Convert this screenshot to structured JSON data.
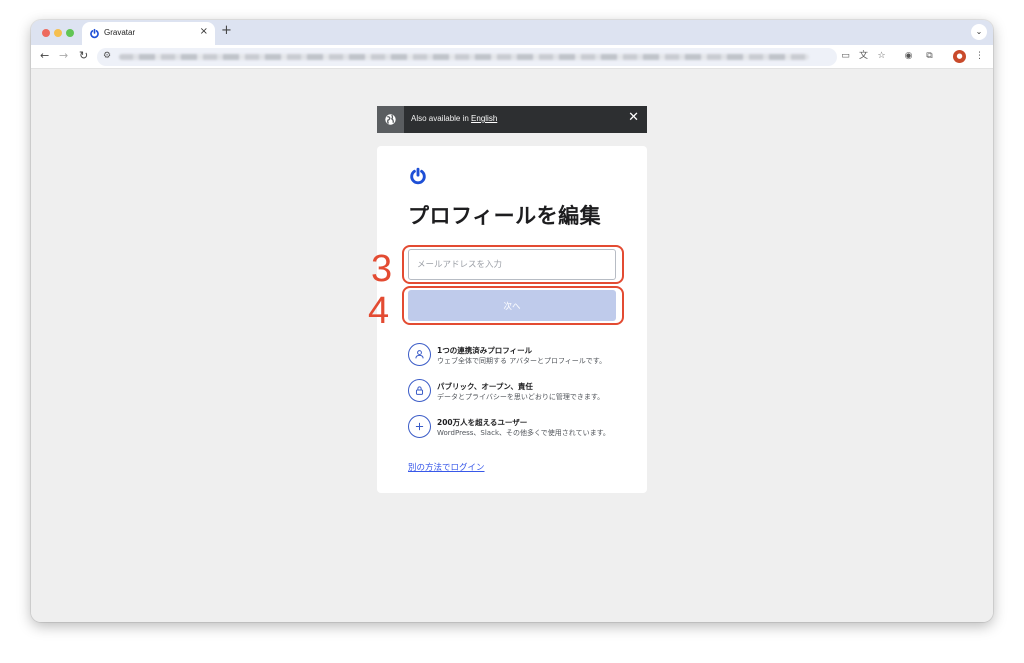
{
  "browser": {
    "tab_title": "Gravatar",
    "tab_close": "×",
    "new_tab": "+",
    "tab_search": "⌄",
    "nav": {
      "back": "←",
      "forward": "→",
      "reload": "↻"
    },
    "site_settings_icon": "⚙",
    "toolbar_icons": [
      "install-icon",
      "translate-icon",
      "bookmark-star-icon",
      "password-manager-icon",
      "extensions-icon",
      "profile-avatar-icon",
      "menu-icon"
    ]
  },
  "lang_bar": {
    "prefix": "Also available in ",
    "link": "English",
    "close": "✕"
  },
  "card": {
    "title": "プロフィールを編集",
    "email_placeholder": "メールアドレスを入力",
    "email_value": "",
    "next_label": "次へ",
    "features": [
      {
        "icon": "user-icon",
        "title": "1つの連携済みプロフィール",
        "desc": "ウェブ全体で同期する アバターとプロフィールです。"
      },
      {
        "icon": "lock-icon",
        "title": "パブリック、オープン、責任",
        "desc": "データとプライバシーを思いどおりに管理できます。"
      },
      {
        "icon": "plus-icon",
        "title": "200万人を超えるユーザー",
        "desc": "WordPress、Slack、その他多くで使用されています。"
      }
    ],
    "alt_login": "別の方法でログイン"
  },
  "annotations": [
    "3",
    "4"
  ],
  "colors": {
    "accent": "#3a5bc7",
    "button_disabled": "#bfcbeb",
    "annotation": "#e34b32",
    "link": "#3858e9"
  }
}
